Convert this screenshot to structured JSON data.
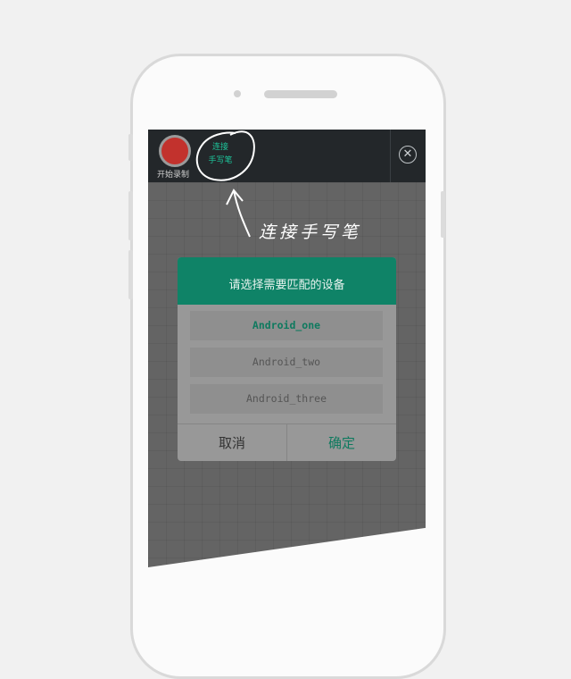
{
  "toolbar": {
    "record_label": "开始录制",
    "connect_line1": "连接",
    "connect_line2": "手写笔",
    "close_icon": "close-icon",
    "record_color": "#c2322d",
    "connect_color": "#1dc49a"
  },
  "annotation": {
    "text": "连接手写笔"
  },
  "dialog": {
    "title": "请选择需要匹配的设备",
    "devices": [
      {
        "label": "Android_one",
        "selected": true
      },
      {
        "label": "Android_two",
        "selected": false
      },
      {
        "label": "Android_three",
        "selected": false
      }
    ],
    "cancel_label": "取消",
    "ok_label": "确定",
    "header_color": "#0f8367"
  }
}
